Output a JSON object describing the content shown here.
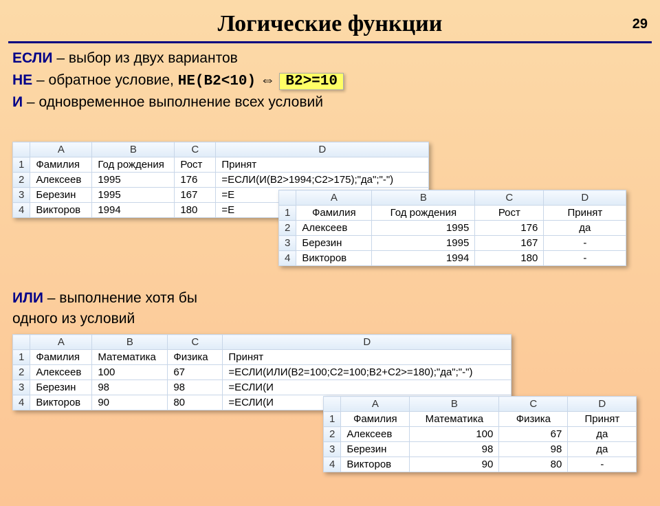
{
  "pageNumber": "29",
  "title": "Логические функции",
  "lines": {
    "esli": {
      "kw": "ЕСЛИ",
      "rest": " – выбор из двух вариантов"
    },
    "ne": {
      "kw": "НЕ",
      "rest": " – обратное условие,  ",
      "code": "НЕ(B2<10)",
      "arrow": " ⇔ ",
      "hl": "B2>=10"
    },
    "i": {
      "kw": "И",
      "rest": " – одновременное выполнение всех условий"
    },
    "ili": {
      "kw": "ИЛИ",
      "rest1": " – выполнение хотя бы",
      "rest2": "одного из условий"
    }
  },
  "colLabels": {
    "a": "A",
    "b": "B",
    "c": "C",
    "d": "D"
  },
  "rowLabels": {
    "r1": "1",
    "r2": "2",
    "r3": "3",
    "r4": "4"
  },
  "table1": {
    "headers": {
      "a": "Фамилия",
      "b": "Год рождения",
      "c": "Рост",
      "d": "Принят"
    },
    "rows": [
      {
        "a": "Алексеев",
        "b": "1995",
        "c": "176",
        "d": "=ЕСЛИ(И(B2>1994;C2>175);\"да\";\"-\")"
      },
      {
        "a": "Березин",
        "b": "1995",
        "c": "167",
        "d": "=Е"
      },
      {
        "a": "Викторов",
        "b": "1994",
        "c": "180",
        "d": "=Е"
      }
    ]
  },
  "table2": {
    "headers": {
      "a": "Фамилия",
      "b": "Год рождения",
      "c": "Рост",
      "d": "Принят"
    },
    "rows": [
      {
        "a": "Алексеев",
        "b": "1995",
        "c": "176",
        "d": "да"
      },
      {
        "a": "Березин",
        "b": "1995",
        "c": "167",
        "d": "-"
      },
      {
        "a": "Викторов",
        "b": "1994",
        "c": "180",
        "d": "-"
      }
    ]
  },
  "table3": {
    "headers": {
      "a": "Фамилия",
      "b": "Математика",
      "c": "Физика",
      "d": "Принят"
    },
    "rows": [
      {
        "a": "Алексеев",
        "b": "100",
        "c": "67",
        "d": "=ЕСЛИ(ИЛИ(B2=100;C2=100;B2+C2>=180);\"да\";\"-\")"
      },
      {
        "a": "Березин",
        "b": "98",
        "c": "98",
        "d": "=ЕСЛИ(И"
      },
      {
        "a": "Викторов",
        "b": "90",
        "c": "80",
        "d": "=ЕСЛИ(И"
      }
    ]
  },
  "table4": {
    "headers": {
      "a": "Фамилия",
      "b": "Математика",
      "c": "Физика",
      "d": "Принят"
    },
    "rows": [
      {
        "a": "Алексеев",
        "b": "100",
        "c": "67",
        "d": "да"
      },
      {
        "a": "Березин",
        "b": "98",
        "c": "98",
        "d": "да"
      },
      {
        "a": "Викторов",
        "b": "90",
        "c": "80",
        "d": "-"
      }
    ]
  }
}
